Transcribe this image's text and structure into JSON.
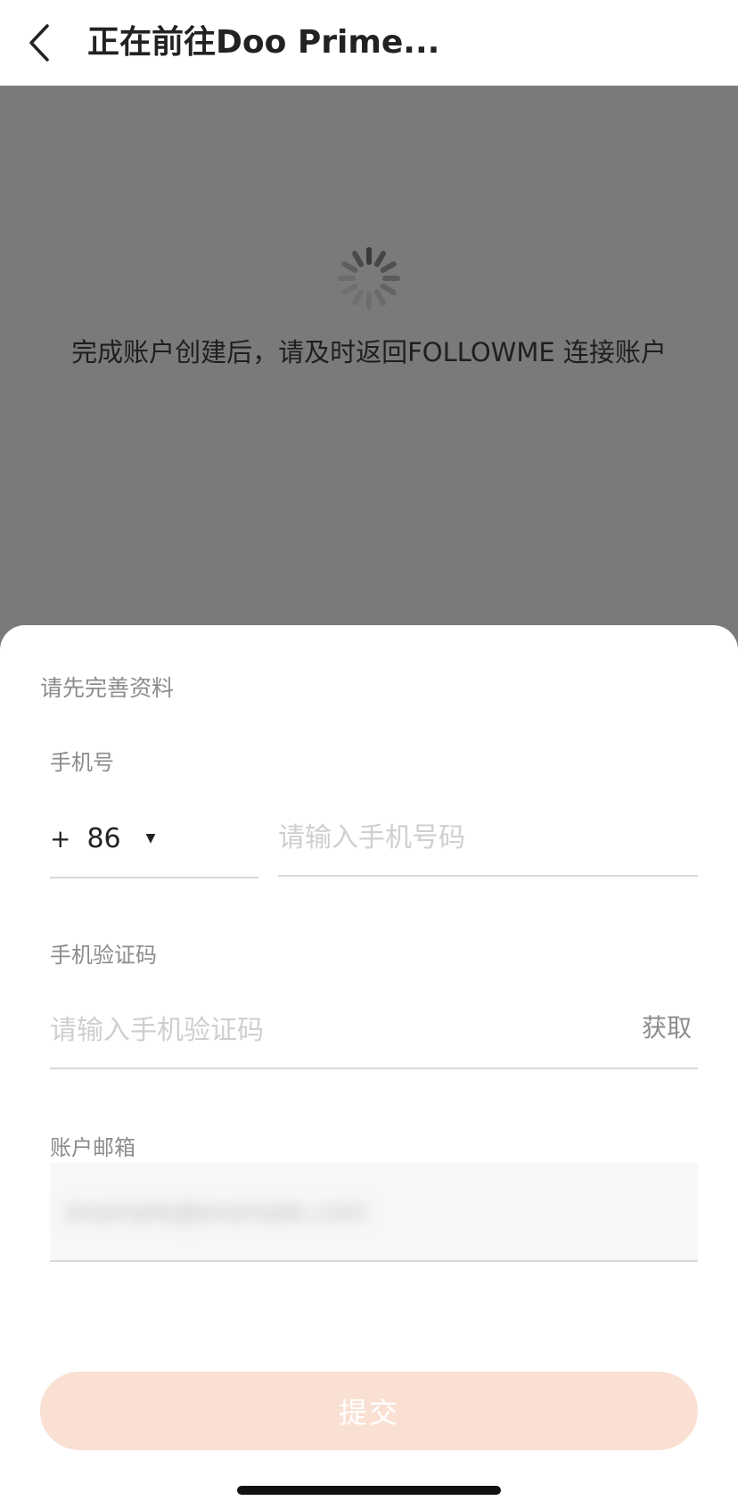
{
  "header": {
    "title": "正在前往Doo Prime..."
  },
  "overlay": {
    "message": "完成账户创建后，请及时返回FOLLOWME 连接账户"
  },
  "form": {
    "title": "请先完善资料",
    "phone": {
      "label": "手机号",
      "country_code_plus": "+",
      "country_code": "86",
      "caret": "▼",
      "placeholder": "请输入手机号码"
    },
    "sms_code": {
      "label": "手机验证码",
      "placeholder": "请输入手机验证码",
      "get_label": "获取"
    },
    "email": {
      "label": "账户邮箱",
      "value": "example@example.com"
    },
    "submit_label": "提交"
  },
  "colors": {
    "overlay": "#7a7a7a",
    "submit_bg": "#f9e0d3",
    "label_text": "#8c8c8c",
    "placeholder_text": "#cfcfcf"
  }
}
